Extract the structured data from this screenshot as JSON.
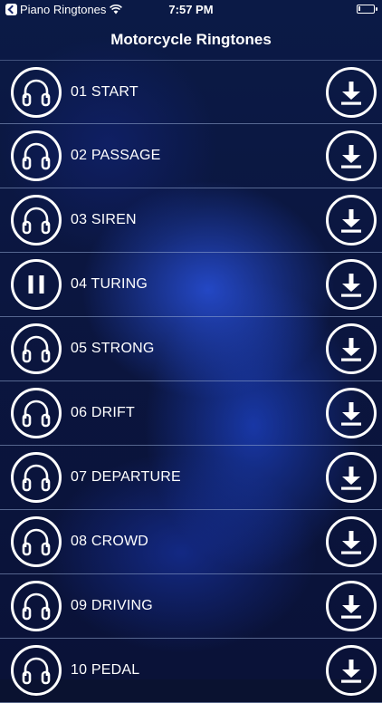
{
  "status_bar": {
    "back_app": "Piano Ringtones",
    "time": "7:57 PM",
    "battery_level": 0.15
  },
  "nav": {
    "title": "Motorcycle Ringtones"
  },
  "tracks": [
    {
      "label": "01 START",
      "icon": "headphones-icon"
    },
    {
      "label": "02 PASSAGE",
      "icon": "headphones-icon"
    },
    {
      "label": "03 SIREN",
      "icon": "headphones-icon"
    },
    {
      "label": "04 TURING",
      "icon": "pause-icon"
    },
    {
      "label": "05 STRONG",
      "icon": "headphones-icon"
    },
    {
      "label": "06 DRIFT",
      "icon": "headphones-icon"
    },
    {
      "label": "07 DEPARTURE",
      "icon": "headphones-icon"
    },
    {
      "label": "08 CROWD",
      "icon": "headphones-icon"
    },
    {
      "label": "09 DRIVING",
      "icon": "headphones-icon"
    },
    {
      "label": "10 PEDAL",
      "icon": "headphones-icon"
    }
  ],
  "download_icon": "download-icon",
  "colors": {
    "background": "#0a1238",
    "accent_glow": "#2850dc",
    "foreground": "#ffffff"
  }
}
